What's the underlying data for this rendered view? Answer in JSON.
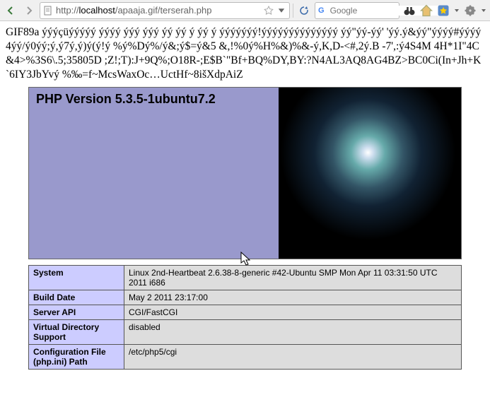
{
  "toolbar": {
    "url_display_prefix": "http://",
    "url_display_host": "localhost",
    "url_display_path": "/apaaja.gif/terserah.php",
    "search_placeholder": "Google"
  },
  "garbage_text": "GIF89a ýýýçüýýýýý ýýýý ýýý ýýý ýý ýý ý ýý ý ýýýýýýý!ýýýýýýýýýýýýýý ýý\"ýý-ýý' 'ýý.ý&ýý\"ýýýý#ýýýý4ýý/ý0ýý;ý,ý7ý,ý)ý(ý!ý %ý%Dý%/ý&;ý$=ý&5 &,!%0ý%H%&)%&-ý,K,D-<#,2ý.B -7',:ý4S4M 4H*1I\"4C&4>%3S6\\.5;35805D ;Z!;T):J+9Q%;O18R-;E$B`\"Bf+BQ%DY,BY:?N4AL3AQ8AG4BZ>BC0Ci(In+Jh+K`6IY3JbYvý %‰=f~McsWaxOc…UctHf~8išXdpAiZ",
  "php": {
    "title": "PHP Version 5.3.5-1ubuntu7.2"
  },
  "info": [
    {
      "k": "System",
      "v": "Linux 2nd-Heartbeat 2.6.38-8-generic #42-Ubuntu SMP Mon Apr 11 03:31:50 UTC 2011 i686"
    },
    {
      "k": "Build Date",
      "v": "May 2 2011 23:17:00"
    },
    {
      "k": "Server API",
      "v": "CGI/FastCGI"
    },
    {
      "k": "Virtual Directory Support",
      "v": "disabled"
    },
    {
      "k": "Configuration File (php.ini) Path",
      "v": "/etc/php5/cgi"
    }
  ]
}
